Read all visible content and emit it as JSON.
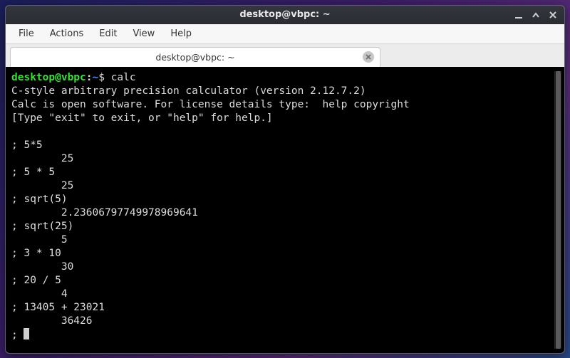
{
  "window": {
    "title": "desktop@vbpc: ~"
  },
  "menubar": {
    "items": [
      "File",
      "Actions",
      "Edit",
      "View",
      "Help"
    ]
  },
  "tab": {
    "title": "desktop@vbpc: ~"
  },
  "prompt": {
    "user_host": "desktop@vbpc",
    "colon": ":",
    "path": "~",
    "dollar": "$ ",
    "command": "calc"
  },
  "terminal": {
    "header": [
      "C-style arbitrary precision calculator (version 2.12.7.2)",
      "Calc is open software. For license details type:  help copyright",
      "[Type \"exit\" to exit, or \"help\" for help.]",
      ""
    ],
    "session": [
      {
        "in": "5*5",
        "out": "25"
      },
      {
        "in": "5 * 5",
        "out": "25"
      },
      {
        "in": "sqrt(5)",
        "out": "2.23606797749978969641"
      },
      {
        "in": "sqrt(25)",
        "out": "5"
      },
      {
        "in": "3 * 10",
        "out": "30"
      },
      {
        "in": "20 / 5",
        "out": "4"
      },
      {
        "in": "13405 + 23021",
        "out": "36426"
      }
    ],
    "pending_prompt": "; "
  }
}
